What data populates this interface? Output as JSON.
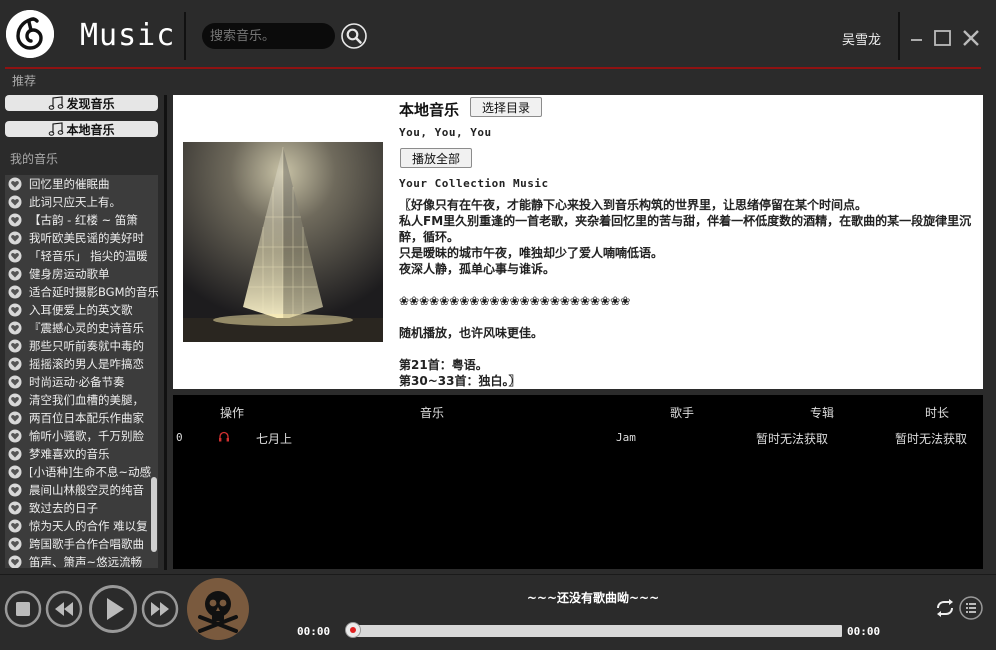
{
  "header": {
    "app_title": "Music",
    "search_placeholder": "搜索音乐。",
    "username": "吴雪龙"
  },
  "sidebar": {
    "recommend_label": "推荐",
    "nav": [
      {
        "label": "发现音乐",
        "icon": "music-note-icon"
      },
      {
        "label": "本地音乐",
        "icon": "music-note-icon"
      }
    ],
    "my_music_label": "我的音乐",
    "playlists": [
      "回忆里的催眠曲",
      "此词只应天上有。",
      "【古韵 - 红楼 ~ 笛箫",
      "我听欧美民谣的美好时",
      "「轻音乐」 指尖的温暖",
      "健身房运动歌单",
      "适合延时摄影BGM的音乐",
      "入耳便爱上的英文歌",
      "『震撼心灵的史诗音乐",
      "那些只听前奏就中毒的",
      "摇摇滚的男人是咋搞恋",
      "时尚运动·必备节奏",
      "清空我们血槽的美腿，",
      "两百位日本配乐作曲家",
      "愉听小骚歌，千万别脸",
      "梦难喜欢的音乐",
      "[小语种]生命不息~动感",
      "晨间山林般空灵的纯音",
      "致过去的日子",
      "惊为天人的合作 难以复",
      "跨国歌手合作合唱歌曲",
      "笛声、箫声~悠远流畅"
    ]
  },
  "main": {
    "local_title": "本地音乐",
    "choose_dir_label": "选择目录",
    "line1": "You, You, You",
    "play_all_label": "播放全部",
    "line2": "Your Collection Music",
    "description": [
      "〖好像只有在午夜，才能静下心来投入到音乐构筑的世界里，让思绪停留在某个时间点。",
      "私人FM里久别重逢的一首老歌，夹杂着回忆里的苦与甜，伴着一杯低度数的酒精，在歌曲的某一段旋律里沉醉，循环。",
      "只是暧昧的城市午夜，唯独却少了爱人喃喃低语。",
      "夜深人静，孤单心事与谁诉。",
      "",
      "❀❀❀❀❀❀❀❀❀❀❀❀❀❀❀❀❀❀❀❀❀❀❀",
      "",
      "随机播放，也许风味更佳。",
      "",
      "第21首：粤语。",
      "第30~33首：独白。〗"
    ]
  },
  "table": {
    "headers": {
      "op": "操作",
      "music": "音乐",
      "singer": "歌手",
      "album": "专辑",
      "duration": "时长"
    },
    "rows": [
      {
        "index": "0",
        "title": "七月上",
        "singer": "Jam",
        "album": "暂时无法获取",
        "duration": "暂时无法获取",
        "icon": "headphones-icon"
      }
    ]
  },
  "player": {
    "now_playing": "~~~还没有歌曲呦~~~",
    "current_time": "00:00",
    "total_time": "00:00",
    "progress": 0,
    "accent_color": "#e03030"
  }
}
